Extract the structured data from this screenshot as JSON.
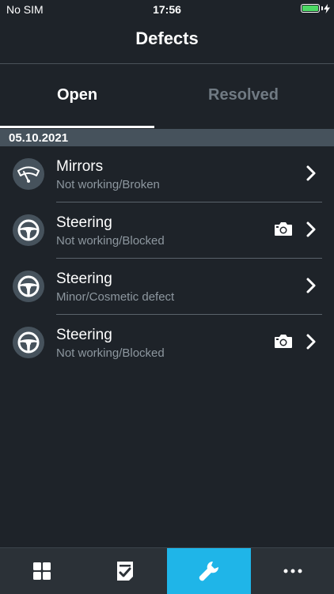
{
  "status_bar": {
    "carrier": "No SIM",
    "time": "17:56",
    "battery_color": "#4cd964"
  },
  "nav": {
    "title": "Defects"
  },
  "tabs": [
    {
      "label": "Open",
      "active": true
    },
    {
      "label": "Resolved",
      "active": false
    }
  ],
  "section": {
    "date": "05.10.2021"
  },
  "defects": [
    {
      "title": "Mirrors",
      "subtitle": "Not working/Broken",
      "icon": "wiper-icon",
      "has_photo": false
    },
    {
      "title": "Steering",
      "subtitle": "Not working/Blocked",
      "icon": "steering-wheel-icon",
      "has_photo": true
    },
    {
      "title": "Steering",
      "subtitle": "Minor/Cosmetic defect",
      "icon": "steering-wheel-icon",
      "has_photo": false
    },
    {
      "title": "Steering",
      "subtitle": "Not working/Blocked",
      "icon": "steering-wheel-icon",
      "has_photo": true
    }
  ],
  "tab_bar": {
    "items": [
      {
        "icon": "dashboard-grid-icon",
        "active": false
      },
      {
        "icon": "checklist-icon",
        "active": false
      },
      {
        "icon": "wrench-icon",
        "active": true
      },
      {
        "icon": "more-dots-icon",
        "active": false
      }
    ],
    "accent_color": "#1fb5e8"
  }
}
